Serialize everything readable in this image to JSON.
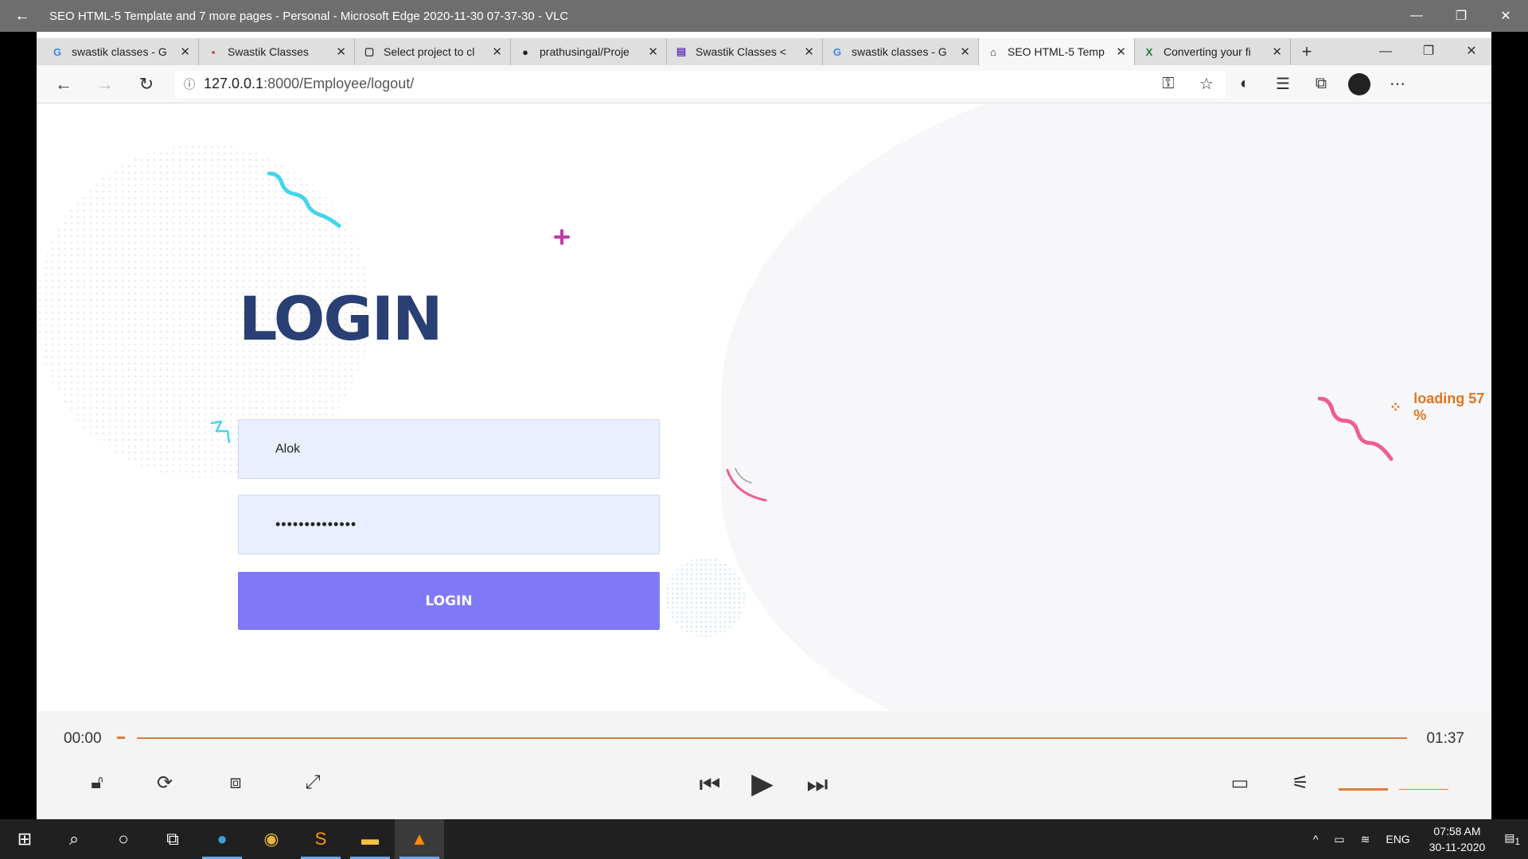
{
  "vlc": {
    "window_title": "SEO HTML-5 Template and 7 more pages - Personal - Microsoft Edge 2020-11-30 07-37-30 - VLC",
    "back_glyph": "←",
    "minimize_glyph": "—",
    "restore_glyph": "❐",
    "close_glyph": "✕",
    "time_current": "00:00",
    "time_total": "01:37",
    "volume_level": 0.5
  },
  "edge": {
    "tabs": [
      {
        "label": "swastik classes - G",
        "icon": "google-icon",
        "glyph": "G",
        "color": "#4285f4"
      },
      {
        "label": "Swastik Classes",
        "icon": "site-icon",
        "glyph": "▪",
        "color": "#d32f2f"
      },
      {
        "label": "Select project to cl",
        "icon": "page-icon",
        "glyph": "▢",
        "color": "#333333"
      },
      {
        "label": "prathusingal/Proje",
        "icon": "github-icon",
        "glyph": "●",
        "color": "#222222"
      },
      {
        "label": "Swastik Classes <",
        "icon": "forms-icon",
        "glyph": "▤",
        "color": "#673ab7"
      },
      {
        "label": "swastik classes - G",
        "icon": "google-icon",
        "glyph": "G",
        "color": "#4285f4"
      },
      {
        "label": "SEO HTML-5 Temp",
        "icon": "home-icon",
        "glyph": "⌂",
        "color": "#222222",
        "active": true
      },
      {
        "label": "Converting your fi",
        "icon": "excel-icon",
        "glyph": "X",
        "color": "#1e7e34"
      }
    ],
    "new_tab_glyph": "+",
    "url_host": "127.0.0.1",
    "url_path": ":8000/Employee/logout/",
    "info_glyph": "ⓘ"
  },
  "page": {
    "heading": "LOGIN",
    "username_value": "Alok",
    "password_value": "••••••••••••••",
    "login_button": "LOGIN",
    "loading_text": "loading 57 %"
  },
  "taskbar": {
    "language": "ENG",
    "time": "07:58 AM",
    "date": "30-11-2020",
    "notifications": "1"
  },
  "colors": {
    "heading": "#2a3f73",
    "button": "#8178f8",
    "field": "#e9effe",
    "accent": "#e07b3b"
  }
}
